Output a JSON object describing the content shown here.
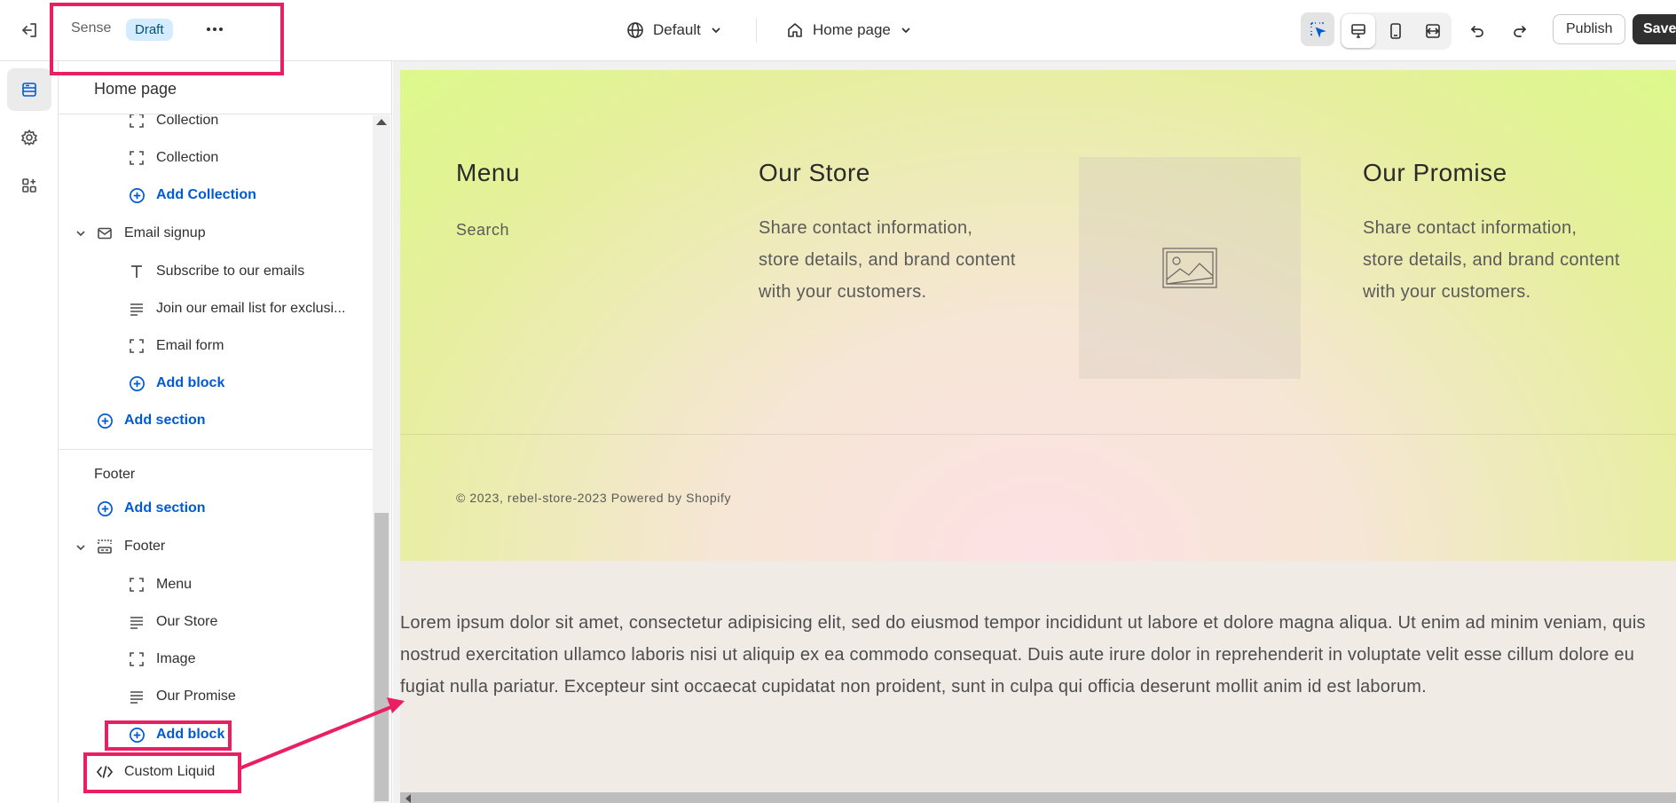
{
  "topbar": {
    "theme_name": "Sense",
    "status_badge": "Draft",
    "more_label": "•••",
    "locale": "Default",
    "page": "Home page",
    "publish_label": "Publish",
    "save_label": "Save"
  },
  "sidebar": {
    "header_title": "Home page",
    "rows": [
      {
        "label": "Collection"
      },
      {
        "label": "Collection"
      },
      {
        "label": "Add Collection"
      },
      {
        "label": "Email signup"
      },
      {
        "label": "Subscribe to our emails"
      },
      {
        "label": "Join our email list for exclusi..."
      },
      {
        "label": "Email form"
      },
      {
        "label": "Add block"
      },
      {
        "label": "Add section"
      },
      {
        "label": "Footer"
      },
      {
        "label": "Add section"
      },
      {
        "label": "Footer"
      },
      {
        "label": "Menu"
      },
      {
        "label": "Our Store"
      },
      {
        "label": "Image"
      },
      {
        "label": "Our Promise"
      },
      {
        "label": "Add block"
      },
      {
        "label": "Custom Liquid"
      }
    ]
  },
  "preview": {
    "menu_title": "Menu",
    "menu_link": "Search",
    "store_title": "Our Store",
    "store_text": "Share contact information, store details, and brand content with your customers.",
    "promise_title": "Our Promise",
    "promise_text": "Share contact information, store details, and brand content with your customers.",
    "copyright": "© 2023, rebel-store-2023 Powered by Shopify",
    "lorem": "Lorem ipsum dolor sit amet, consectetur adipisicing elit, sed do eiusmod tempor incididunt ut labore et dolore magna aliqua. Ut enim ad minim veniam, quis nostrud exercitation ullamco laboris nisi ut aliquip ex ea commodo consequat. Duis aute irure dolor in reprehenderit in voluptate velit esse cillum dolore eu fugiat nulla pariatur. Excepteur sint occaecat cupidatat non proident, sunt in culpa qui officia deserunt mollit anim id est laborum."
  },
  "colors": {
    "accent_link": "#005bd3",
    "annotation": "#ea1e63",
    "save_bg": "#303030"
  }
}
